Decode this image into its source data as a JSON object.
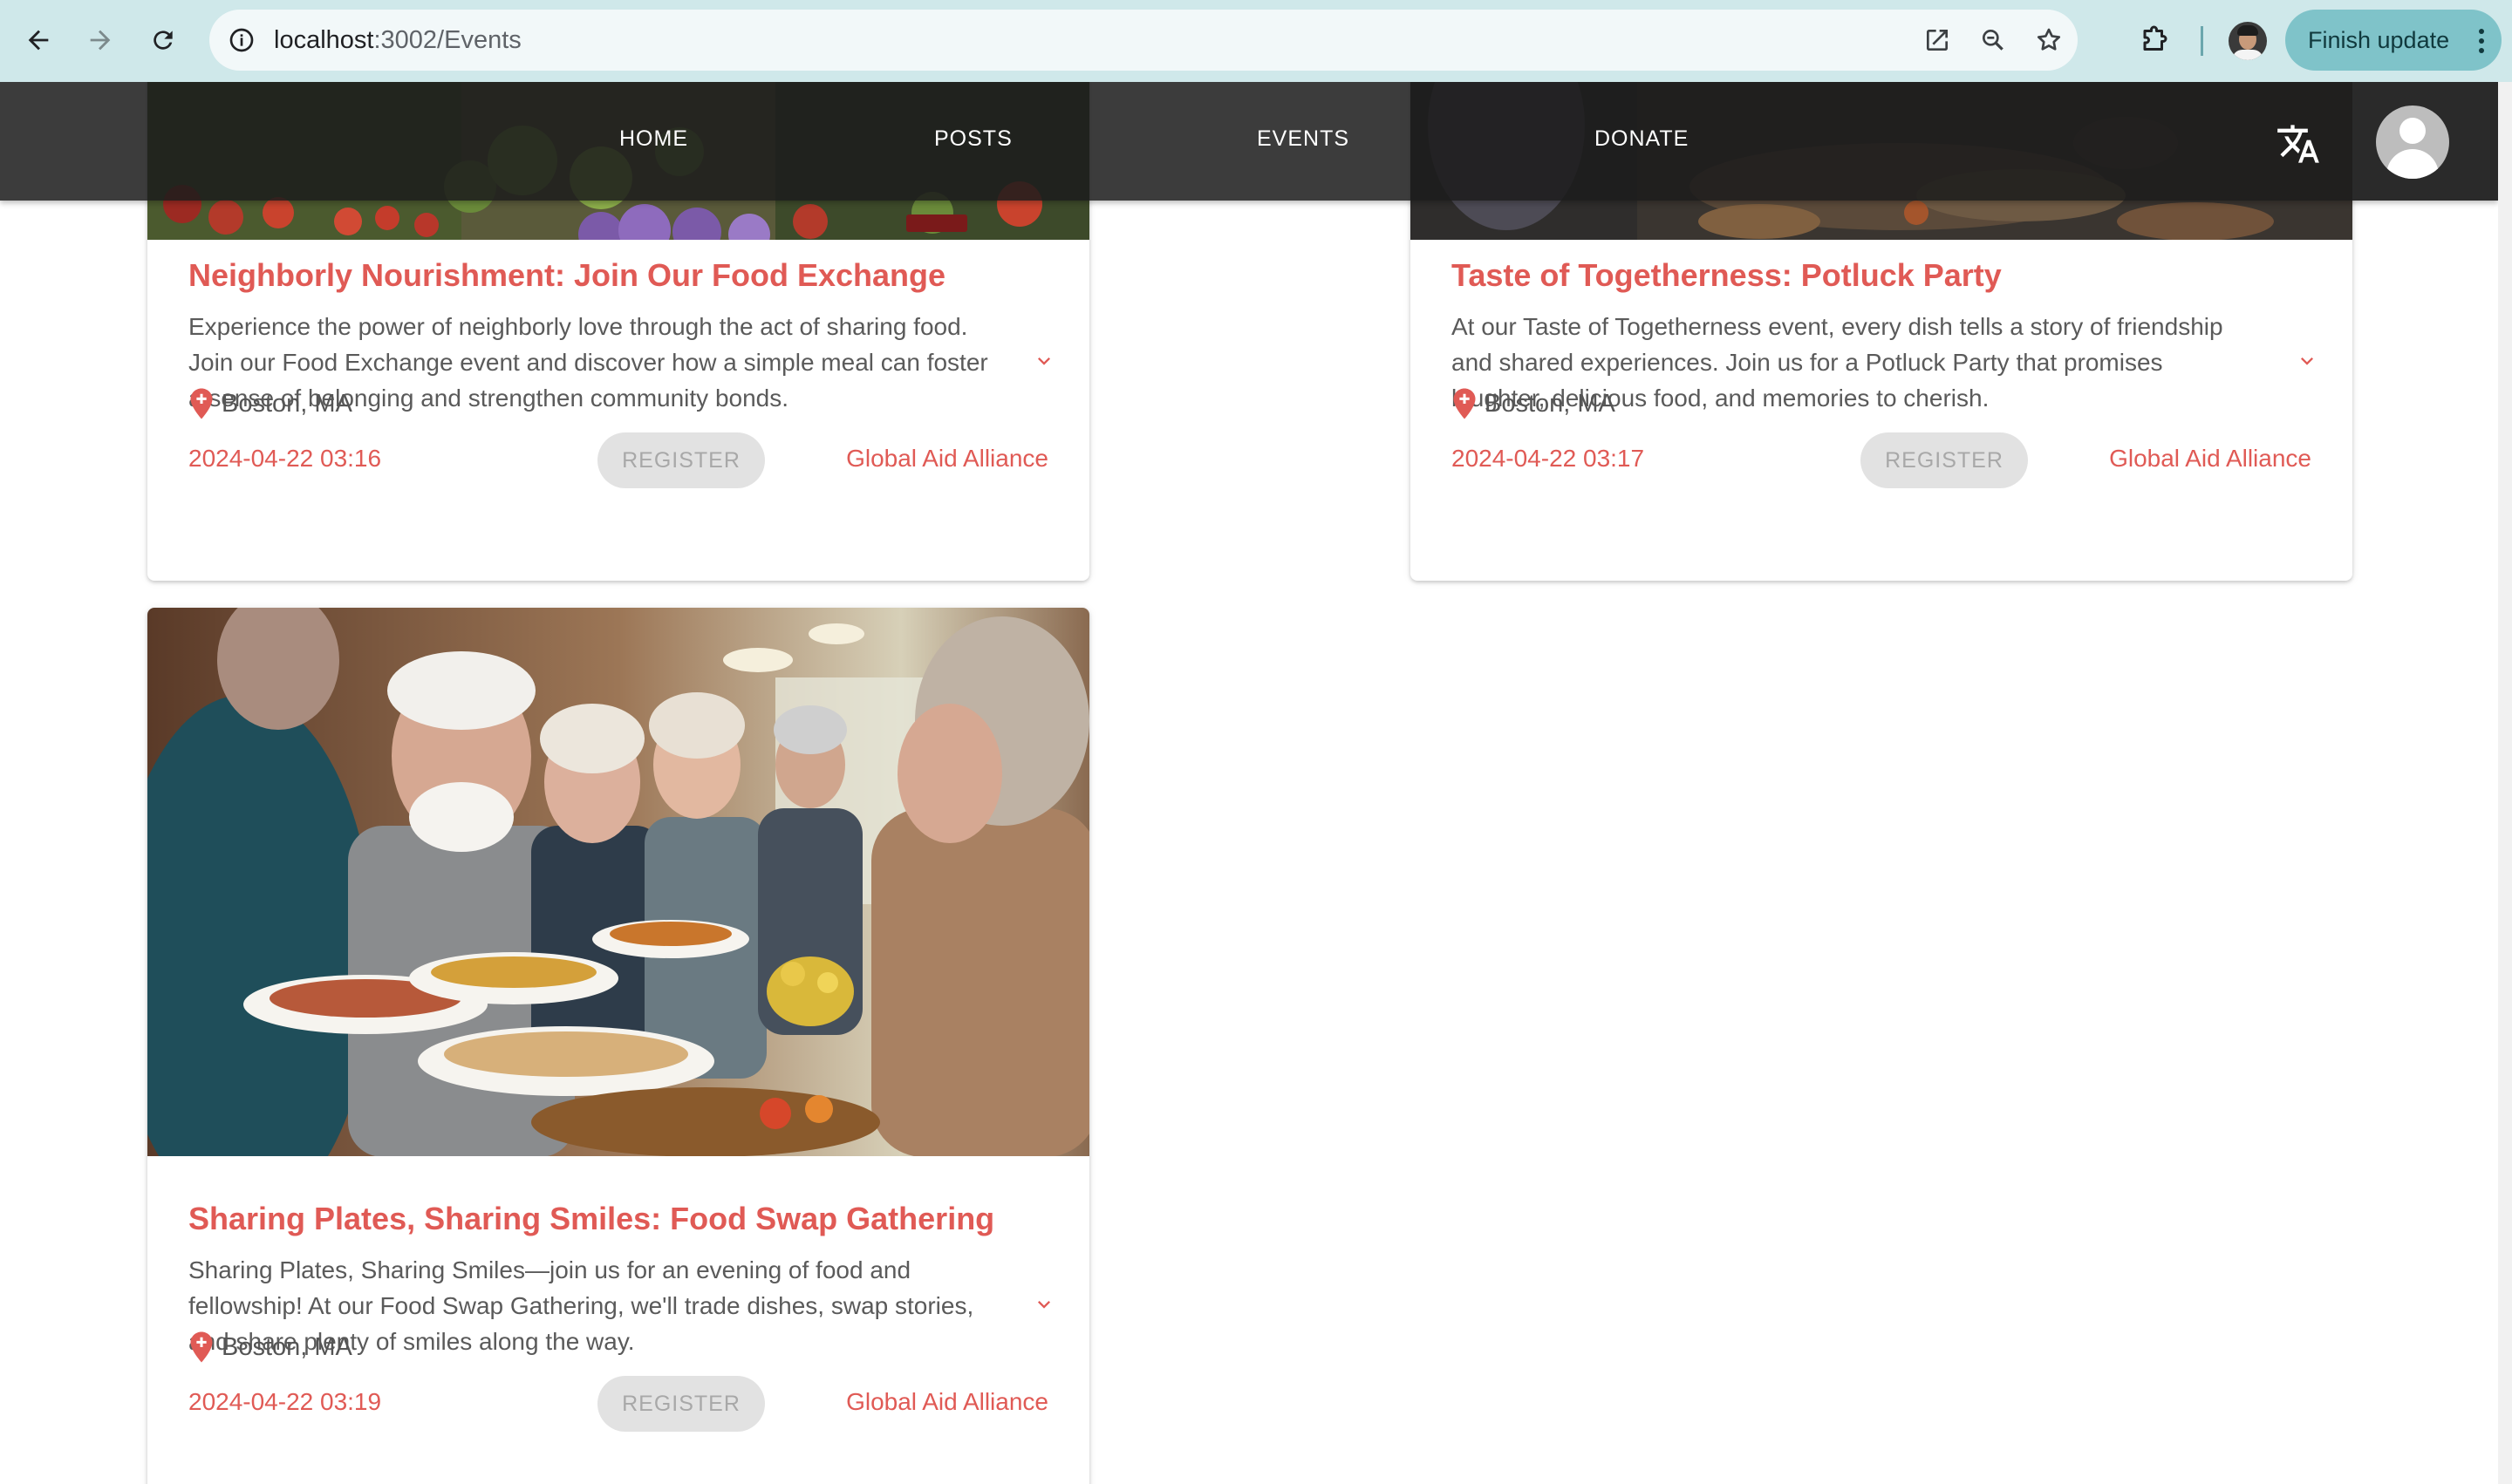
{
  "browser": {
    "url_host": "localhost",
    "url_path": ":3002/Events",
    "finish_update_label": "Finish update",
    "icons": [
      "back-arrow-icon",
      "forward-arrow-icon",
      "reload-icon",
      "site-info-icon",
      "open-in-new-icon",
      "zoom-icon",
      "bookmark-star-icon",
      "extensions-puzzle-icon",
      "profile-avatar",
      "kebab-menu-icon"
    ]
  },
  "appbar": {
    "nav": [
      {
        "label": "HOME"
      },
      {
        "label": "POSTS"
      },
      {
        "label": "EVENTS"
      },
      {
        "label": "DONATE"
      }
    ],
    "translate_icon": "translate-icon",
    "avatar_icon": "account-avatar"
  },
  "events": [
    {
      "title": "Neighborly Nourishment: Join Our Food Exchange",
      "description": "Experience the power of neighborly love through the act of sharing food. Join our Food Exchange event and discover how a simple meal can foster a sense of belonging and strengthen community bonds.",
      "location": "Boston, MA",
      "date": "2024-04-22 03:16",
      "register_label": "REGISTER",
      "organization": "Global Aid Alliance"
    },
    {
      "title": "Taste of Togetherness: Potluck Party",
      "description": "At our Taste of Togetherness event, every dish tells a story of friendship and shared experiences. Join us for a Potluck Party that promises laughter, delicious food, and memories to cherish.",
      "location": "Boston, MA",
      "date": "2024-04-22 03:17",
      "register_label": "REGISTER",
      "organization": "Global Aid Alliance"
    },
    {
      "title": "Sharing Plates, Sharing Smiles: Food Swap Gathering",
      "description": "Sharing Plates, Sharing Smiles—join us for an evening of food and fellowship! At our Food Swap Gathering, we'll trade dishes, swap stories, and share plenty of smiles along the way.",
      "location": "Boston, MA",
      "date": "2024-04-22 03:19",
      "register_label": "REGISTER",
      "organization": "Global Aid Alliance"
    }
  ],
  "colors": {
    "accent": "#e05a55",
    "appbar": "#1c1c1c",
    "chrome": "#cfe8ea",
    "finish_update": "#7fc3c9",
    "register_disabled_bg": "#e2e2e2"
  }
}
